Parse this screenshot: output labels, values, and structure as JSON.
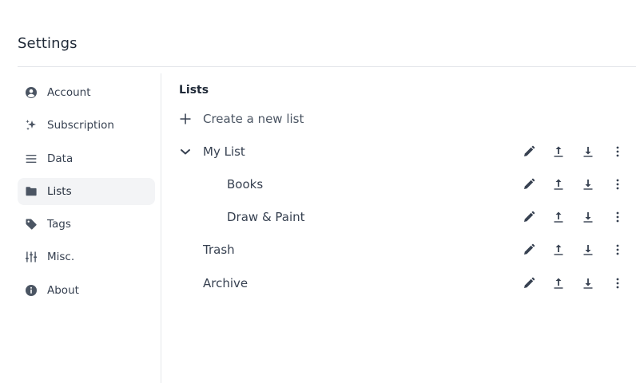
{
  "page": {
    "title": "Settings"
  },
  "sidebar": {
    "items": [
      {
        "label": "Account",
        "icon": "account-circle-icon",
        "active": false
      },
      {
        "label": "Subscription",
        "icon": "sparkles-icon",
        "active": false
      },
      {
        "label": "Data",
        "icon": "menu-lines-icon",
        "active": false
      },
      {
        "label": "Lists",
        "icon": "folder-icon",
        "active": true
      },
      {
        "label": "Tags",
        "icon": "tag-icon",
        "active": false
      },
      {
        "label": "Misc.",
        "icon": "sliders-icon",
        "active": false
      },
      {
        "label": "About",
        "icon": "info-icon",
        "active": false
      }
    ]
  },
  "main": {
    "section_title": "Lists",
    "create_label": "Create a new list",
    "lists": [
      {
        "name": "My List",
        "expanded": true,
        "level": 0
      },
      {
        "name": "Books",
        "level": 1
      },
      {
        "name": "Draw & Paint",
        "level": 1
      },
      {
        "name": "Trash",
        "level": 0
      },
      {
        "name": "Archive",
        "level": 0
      }
    ],
    "action_icons": [
      "edit-icon",
      "upload-icon",
      "download-icon",
      "more-vertical-icon"
    ]
  },
  "colors": {
    "active_bg": "#f3f4f6",
    "divider": "#e5e7eb",
    "icon": "#4b5563"
  }
}
